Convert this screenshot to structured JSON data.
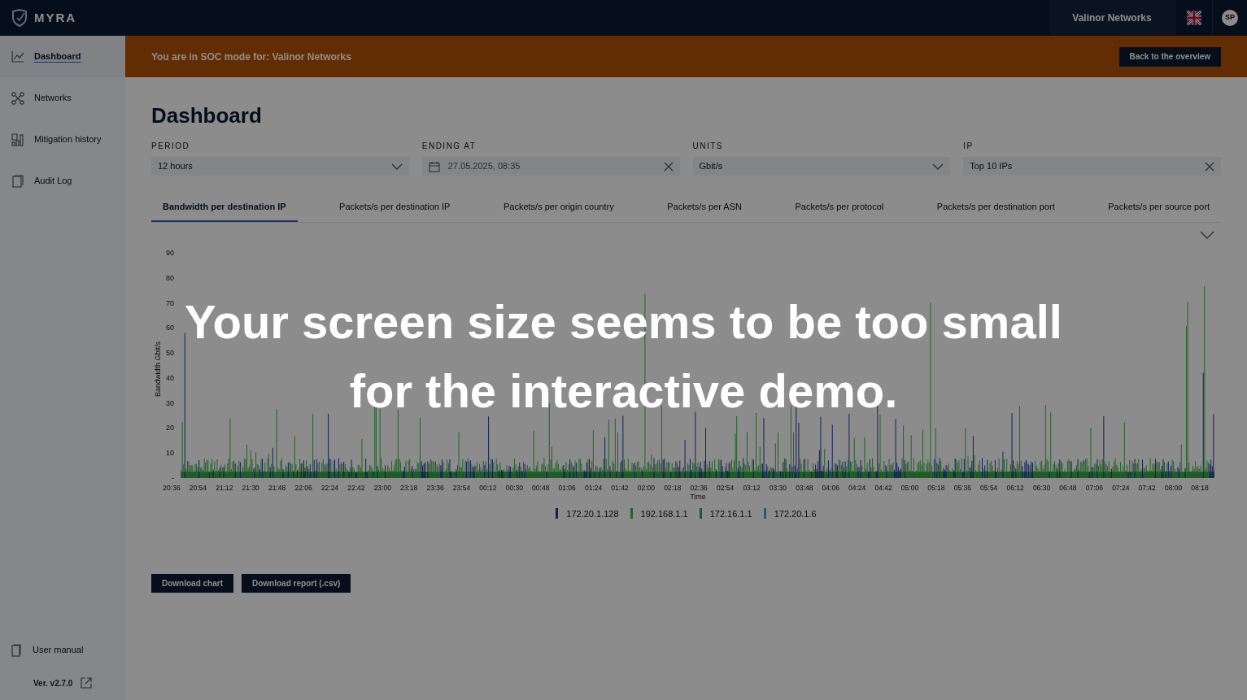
{
  "header": {
    "logo": "MYRA",
    "organization": "Valinor Networks",
    "avatar": "SP"
  },
  "sidebar": {
    "items": [
      {
        "label": "Dashboard",
        "selected": true
      },
      {
        "label": "Networks",
        "selected": false
      },
      {
        "label": "Mitigation history",
        "selected": false
      },
      {
        "label": "Audit Log",
        "selected": false
      }
    ],
    "manual": "User manual",
    "version": "Ver. v2.7.0"
  },
  "banner": {
    "message": "You are in SOC mode for: Valinor Networks",
    "button": "Back to the overview"
  },
  "title": "Dashboard",
  "filters": [
    {
      "label": "PERIOD",
      "kind": "select",
      "value": "12 hours"
    },
    {
      "label": "ENDING AT",
      "kind": "date",
      "value": "27.05.2025, 08:35"
    },
    {
      "label": "UNITS",
      "kind": "select",
      "value": "Gbit/s"
    },
    {
      "label": "IP",
      "kind": "clearable",
      "value": "Top 10 IPs"
    }
  ],
  "tabs": [
    {
      "label": "Bandwidth per destination IP",
      "selected": true
    },
    {
      "label": "Packets/s per destination IP",
      "selected": false
    },
    {
      "label": "Packets/s per origin country",
      "selected": false
    },
    {
      "label": "Packets/s per ASN",
      "selected": false
    },
    {
      "label": "Packets/s per protocol",
      "selected": false
    },
    {
      "label": "Packets/s per destination port",
      "selected": false
    },
    {
      "label": "Packets/s per source port",
      "selected": false
    }
  ],
  "chart": {
    "ylabel": "Bandwidth Gbit/s",
    "xlabel": "Time",
    "y_ticks": [
      "90",
      "80",
      "70",
      "60",
      "50",
      "40",
      "30",
      "20",
      "10",
      "-"
    ],
    "x_ticks": [
      "20:36",
      "20:54",
      "21:12",
      "21:30",
      "21:48",
      "22:06",
      "22:24",
      "22:42",
      "23:00",
      "23:18",
      "23:36",
      "23:54",
      "00:12",
      "00:30",
      "00:48",
      "01:06",
      "01:24",
      "01:42",
      "02:00",
      "02:18",
      "02:36",
      "02:54",
      "03:12",
      "03:30",
      "03:48",
      "04:06",
      "04:24",
      "04:42",
      "05:00",
      "05:18",
      "05:36",
      "05:54",
      "06:12",
      "06:30",
      "06:48",
      "07:06",
      "07:24",
      "07:42",
      "08:00",
      "08:18"
    ],
    "legend": [
      {
        "label": "172.20.1.128",
        "color": "#141f5c"
      },
      {
        "label": "192.168.1.1",
        "color": "#236329"
      },
      {
        "label": "172.16.1.1",
        "color": "#19563d"
      },
      {
        "label": "172.20.1.6",
        "color": "#295a77"
      }
    ]
  },
  "buttons": [
    "Download chart",
    "Download report (.csv)"
  ],
  "overlay": {
    "lines": [
      "Your screen size seems to be too small",
      "for the interactive demo."
    ]
  }
}
